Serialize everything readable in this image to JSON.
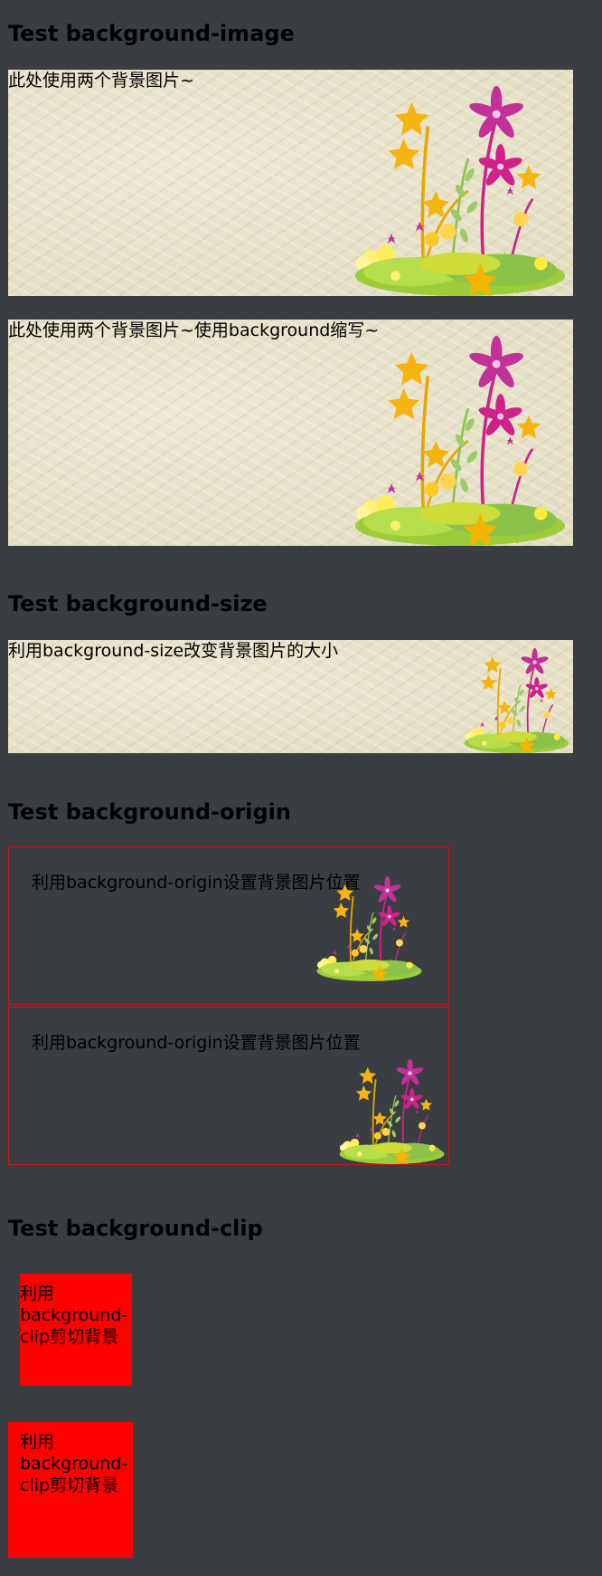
{
  "sections": {
    "image": {
      "heading": "Test background-image",
      "text1": "此处使用两个背景图片~",
      "text2": "此处使用两个背景图片~使用background缩写~"
    },
    "size": {
      "heading": "Test background-size",
      "text": "利用background-size改变背景图片的大小"
    },
    "origin": {
      "heading": "Test background-origin",
      "text1": "利用background-origin设置背景图片位置",
      "text2": "利用background-origin设置背景图片位置"
    },
    "clip": {
      "heading": "Test background-clip",
      "text1": "利用\nbackground-\nclip剪切背景",
      "text2": "利用\nbackground-\nclip剪切背景"
    }
  },
  "colors": {
    "page_background": "#3a3e42",
    "paper": "#e6e1c8",
    "origin_border": "#c8161c",
    "clip_fill": "#ff0000"
  },
  "icons": [
    "flower-bouquet-icon"
  ]
}
